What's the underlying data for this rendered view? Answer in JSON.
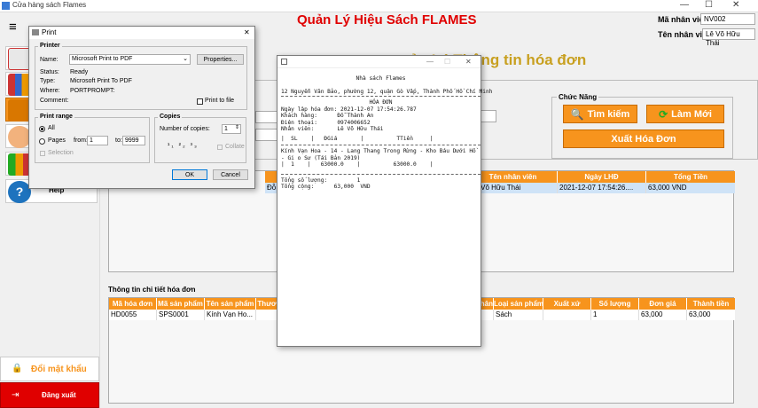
{
  "window": {
    "title": "Cửa hàng sách Flames",
    "min": "—",
    "max": "☐",
    "close": "✕"
  },
  "header": {
    "title": "Quản Lý Hiệu Sách FLAMES"
  },
  "employee": {
    "id_label": "Mã nhân viên:",
    "id_value": "NV002",
    "name_label": "Tên nhân viên:",
    "name_value": "Lê Võ Hữu Thái"
  },
  "sidebar": {
    "help_label": "Help",
    "change_password": "Đổi mật khẩu",
    "logout": "Đăng xuất"
  },
  "main": {
    "section_title": "...ản Lý Thông tin hóa đơn",
    "functions_label": "Chức Năng",
    "search_btn": "Tìm kiếm",
    "refresh_btn": "Làm Mới",
    "export_btn": "Xuất Hóa Đơn",
    "details_label": "Thông tin chi tiết hóa đơn"
  },
  "invoice_table": {
    "columns": [
      "Tên nhân viên",
      "Ngày LHĐ",
      "Tổng Tiền"
    ],
    "rows": [
      {
        "partial": "Đỗ",
        "employee": "Lê Võ Hữu Thái",
        "date": "2021-12-07 17:54:26....",
        "total": "63,000 VND"
      }
    ]
  },
  "detail_table": {
    "columns": [
      "Mã hóa đơn",
      "Mã sản phẩm",
      "Tên sản phẩm",
      "Thươn",
      "hân",
      "Loại sản phẩm",
      "Xuất xứ",
      "Số lượng",
      "Đơn giá",
      "Thành tiền"
    ],
    "rows": [
      [
        "HD0055",
        "SPS0001",
        "Kính Vạn Ho...",
        "",
        "",
        "Sách",
        "",
        "1",
        "63,000",
        "63,000"
      ]
    ]
  },
  "print_dialog": {
    "title": "Print",
    "printer_group": "Printer",
    "name_label": "Name:",
    "name_value": "Microsoft Print to PDF",
    "properties_btn": "Properties...",
    "status_label": "Status:",
    "status_value": "Ready",
    "type_label": "Type:",
    "type_value": "Microsoft Print To PDF",
    "where_label": "Where:",
    "where_value": "PORTPROMPT:",
    "comment_label": "Comment:",
    "print_to_file": "Print to file",
    "range_group": "Print range",
    "all_label": "All",
    "pages_label": "Pages",
    "from_label": "from:",
    "from_value": "1",
    "to_label": "to:",
    "to_value": "9999",
    "selection_label": "Selection",
    "copies_group": "Copies",
    "num_copies_label": "Number of copies:",
    "num_copies_value": "1",
    "collate_label": "Collate",
    "ok_btn": "OK",
    "cancel_btn": "Cancel"
  },
  "preview": {
    "store": "Nhà sách Flames",
    "address": "12 Nguyễn Văn Bảo, phường 12, quận Gò Vấp, Thành Phố Hồ Chí Minh",
    "doc_title": "HÓA ĐƠN",
    "date_line": "Ngày lập hóa đơn: 2021-12-07 17:54:26.787",
    "customer_line": "Khách hàng:      Đỗ Thành An",
    "phone_line": "Điện thoại:      0974006652",
    "staff_line": "Nhân viên:       Lê Võ Hữu Thái",
    "table_header": "|  SL    |   ĐGiá       |          TTiền     |",
    "product_line": "Kính Vạn Hoa - 14 - Lang Thang Trong Rừng - Kho Báu Dưới Hồ - Gi o Sư (Tái Bản 2019)",
    "product_values": "|  1    |   63000.0    |          63000.0    |",
    "qty_line": "Tổng số lượng:         1",
    "total_line": "Tổng cộng:      63,000  VND"
  }
}
